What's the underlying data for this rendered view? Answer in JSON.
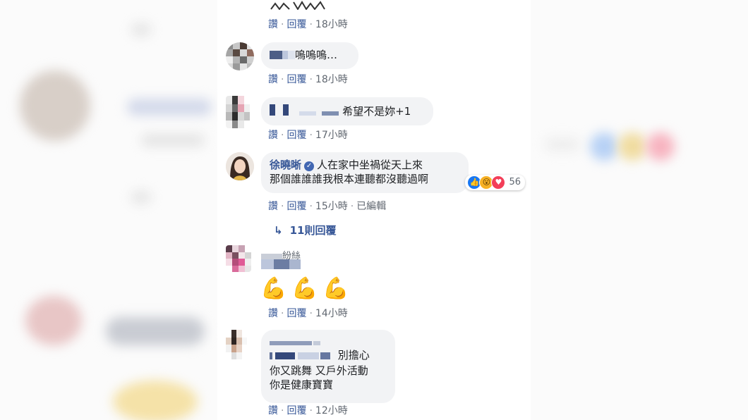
{
  "actions": {
    "like": "讚",
    "reply": "回覆",
    "edited": "已編輯"
  },
  "comments": [
    {
      "text": "",
      "time": "18小時"
    },
    {
      "text": "嗚嗚嗚…",
      "time": "18小時"
    },
    {
      "text": "希望不是妳+1",
      "time": "17小時"
    },
    {
      "author": "徐曉晰",
      "text_line1": "人在家中坐禍從天上來",
      "text_line2": "那個誰誰誰我根本連聽都沒聽過啊",
      "time": "15小時",
      "reaction_count": "56",
      "replies_label": "11則回覆"
    },
    {
      "author_suffix": "紛絲",
      "text": "",
      "time": "14小時"
    },
    {
      "text_line1": "別擔心",
      "text_line2": "你又跳舞 又戶外活動",
      "text_line3": "你是健康寶寶",
      "time": "12小時"
    }
  ],
  "icons": {
    "reply_arrow": "reply-arrow-icon",
    "verified": "verified-badge-icon",
    "muscle": "flexed-biceps-emoji"
  },
  "colors": {
    "link": "#385898",
    "bubble": "#f2f3f5",
    "muted": "#606770",
    "like": "#1877f2",
    "wow": "#f7b125",
    "love": "#f33e58"
  }
}
